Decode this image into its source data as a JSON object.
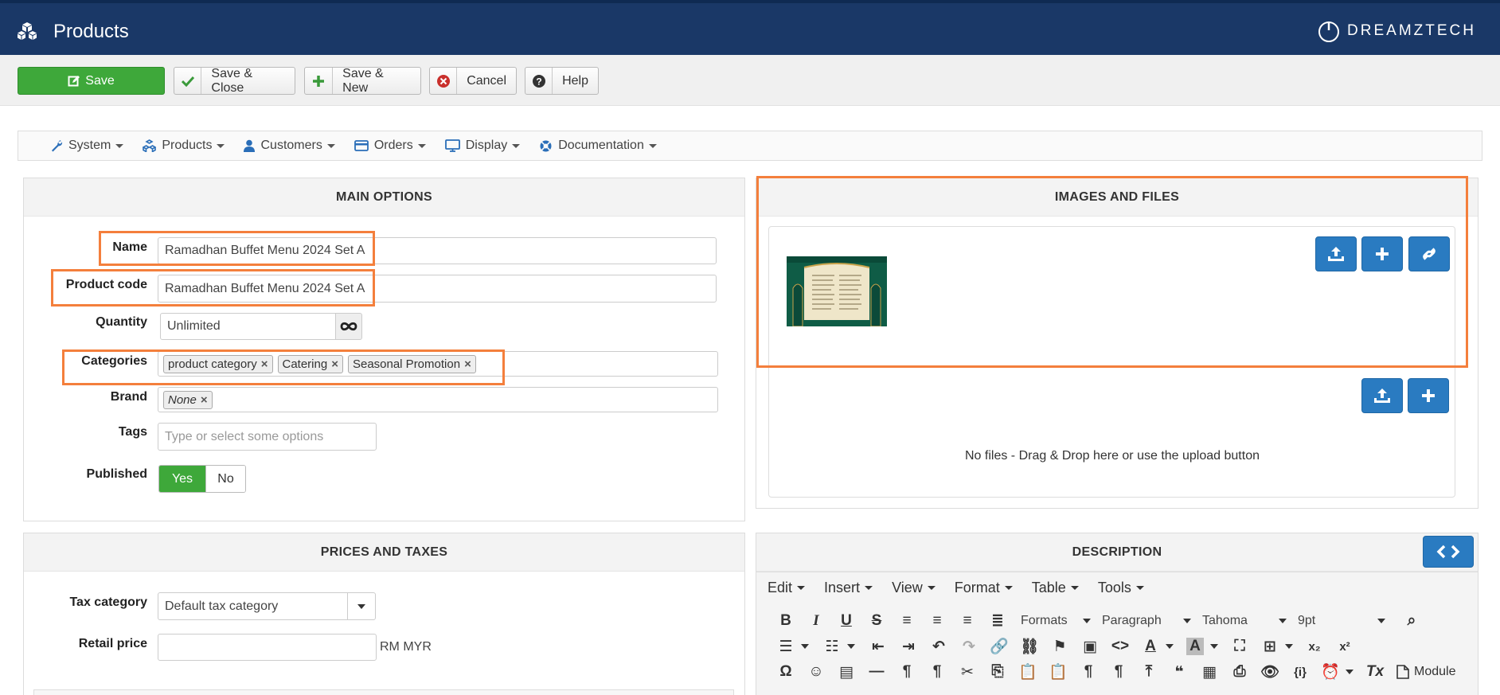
{
  "header": {
    "title": "Products",
    "brand": "DREAMZTECH"
  },
  "toolbar": {
    "save": "Save",
    "save_close": "Save & Close",
    "save_new": "Save & New",
    "cancel": "Cancel",
    "help": "Help"
  },
  "menu": {
    "system": "System",
    "products": "Products",
    "customers": "Customers",
    "orders": "Orders",
    "display": "Display",
    "documentation": "Documentation"
  },
  "main_options": {
    "heading": "MAIN OPTIONS",
    "name_label": "Name",
    "name_value": "Ramadhan Buffet Menu 2024 Set A",
    "code_label": "Product code",
    "code_value": "Ramadhan Buffet Menu 2024 Set A",
    "quantity_label": "Quantity",
    "quantity_value": "Unlimited",
    "categories_label": "Categories",
    "categories": [
      "product category",
      "Catering",
      "Seasonal Promotion"
    ],
    "brand_label": "Brand",
    "brand_value": "None",
    "tags_label": "Tags",
    "tags_placeholder": "Type or select some options",
    "published_label": "Published",
    "published_yes": "Yes",
    "published_no": "No"
  },
  "images_files": {
    "heading": "IMAGES AND FILES",
    "no_files": "No files - Drag & Drop here or use the upload button"
  },
  "prices": {
    "heading": "PRICES AND TAXES",
    "tax_label": "Tax category",
    "tax_value": "Default tax category",
    "retail_label": "Retail price",
    "retail_value": "",
    "currency": "RM MYR"
  },
  "description": {
    "heading": "DESCRIPTION",
    "menus": [
      "Edit",
      "Insert",
      "View",
      "Format",
      "Table",
      "Tools"
    ],
    "formats": "Formats",
    "paragraph": "Paragraph",
    "font": "Tahoma",
    "size": "9pt",
    "module": "Module"
  },
  "colors": {
    "header_bg": "#1a3867",
    "save_green": "#3ea83a",
    "highlight_orange": "#f47f3c",
    "action_blue": "#2a7bc1"
  }
}
